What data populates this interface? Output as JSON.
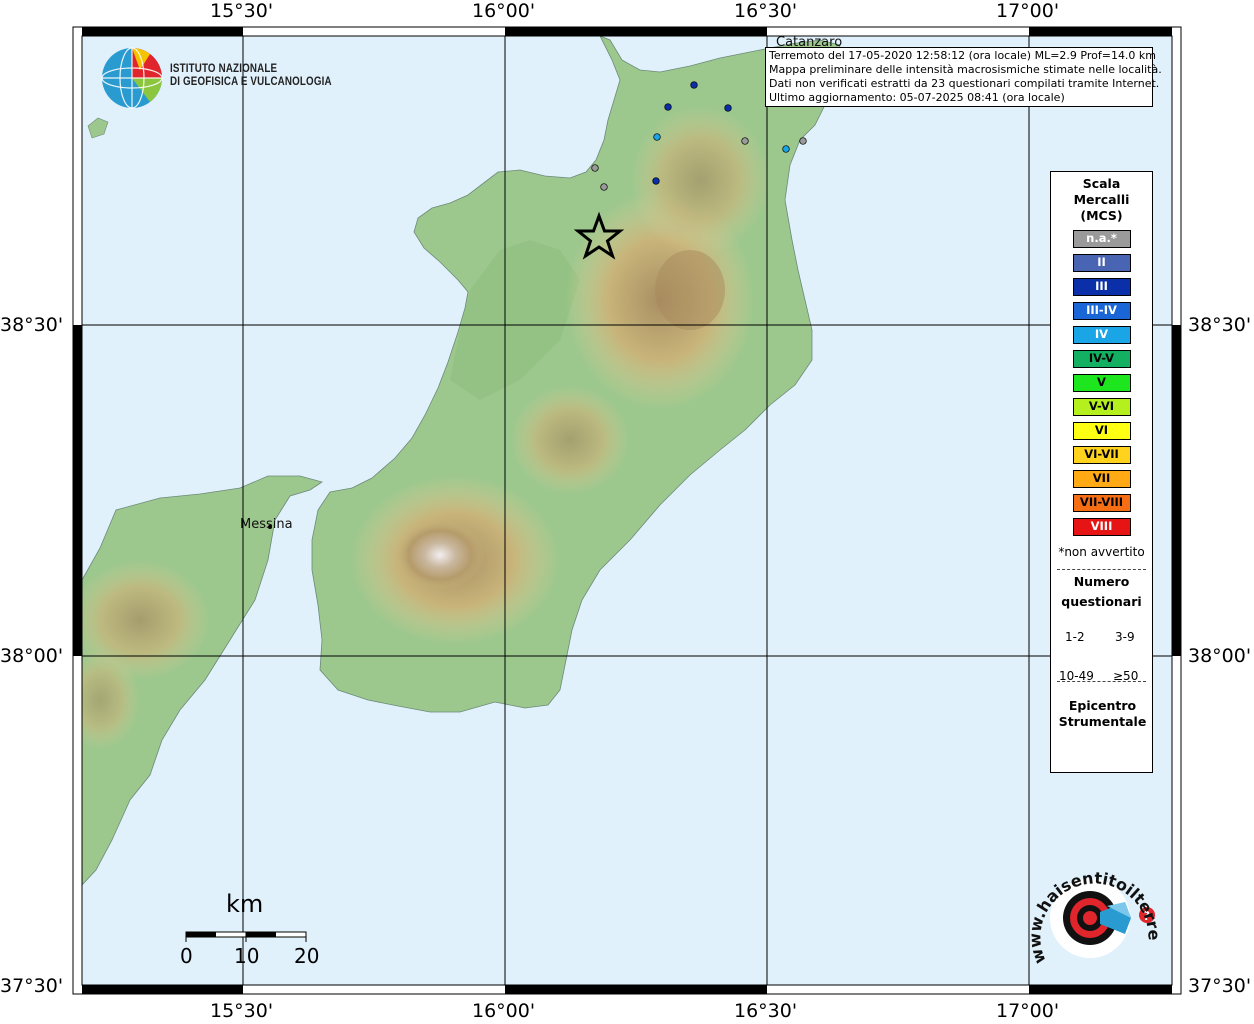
{
  "header": {
    "institute_line1": "ISTITUTO NAZIONALE",
    "institute_line2": "DI GEOFISICA E VULCANOLOGIA"
  },
  "info": {
    "line1": "Terremoto del 17-05-2020 12:58:12 (ora locale) ML=2.9 Prof=14.0 km",
    "line2": "Mappa preliminare delle intensità macrosismiche stimate nelle località.",
    "line3": "Dati non verificati estratti da 23 questionari compilati tramite Internet.",
    "line4": "Ultimo aggiornamento: 05-07-2025 08:41 (ora locale)"
  },
  "cities": {
    "catanzaro": "Catanzaro",
    "messina": "Messina"
  },
  "axes": {
    "lon_labels": [
      "15°30'",
      "16°00'",
      "16°30'",
      "17°00'"
    ],
    "lat_labels": [
      "38°30'",
      "38°00'",
      "37°30'"
    ]
  },
  "legend": {
    "title1": "Scala",
    "title2": "Mercalli",
    "title3": "(MCS)",
    "classes": [
      {
        "label": "n.a.*",
        "color": "#9a9a9a",
        "text": "#ffffff"
      },
      {
        "label": "II",
        "color": "#4a64b4",
        "text": "#ffffff"
      },
      {
        "label": "III",
        "color": "#0a2fa8",
        "text": "#ffffff"
      },
      {
        "label": "III-IV",
        "color": "#1a66d6",
        "text": "#ffffff"
      },
      {
        "label": "IV",
        "color": "#1aa6e6",
        "text": "#ffffff"
      },
      {
        "label": "IV-V",
        "color": "#12b060",
        "text": "#000000"
      },
      {
        "label": "V",
        "color": "#1ee61e",
        "text": "#000000"
      },
      {
        "label": "V-VI",
        "color": "#b4f01e",
        "text": "#000000"
      },
      {
        "label": "VI",
        "color": "#ffff14",
        "text": "#000000"
      },
      {
        "label": "VI-VII",
        "color": "#ffd21e",
        "text": "#000000"
      },
      {
        "label": "VII",
        "color": "#ffaa14",
        "text": "#000000"
      },
      {
        "label": "VII-VIII",
        "color": "#f56e14",
        "text": "#000000"
      },
      {
        "label": "VIII",
        "color": "#e61414",
        "text": "#ffffff"
      }
    ],
    "not_felt_note": "*non avvertito",
    "questionnaires_title1": "Numero",
    "questionnaires_title2": "questionari",
    "sizes": [
      "1-2",
      "3-9",
      "10-49",
      "≥50"
    ],
    "epicenter_title1": "Epicentro",
    "epicenter_title2": "Strumentale"
  },
  "scale_bar": {
    "unit": "km",
    "labels": [
      "0",
      "10",
      "20"
    ]
  },
  "observations": [
    {
      "intensity": "III",
      "color": "#0a2fa8"
    },
    {
      "intensity": "III",
      "color": "#0a2fa8"
    },
    {
      "intensity": "III",
      "color": "#0a2fa8"
    },
    {
      "intensity": "III",
      "color": "#0a2fa8"
    },
    {
      "intensity": "IV",
      "color": "#1aa6e6"
    },
    {
      "intensity": "IV",
      "color": "#1aa6e6"
    },
    {
      "intensity": "n.a.*",
      "color": "#9a9a9a"
    },
    {
      "intensity": "n.a.*",
      "color": "#9a9a9a"
    },
    {
      "intensity": "n.a.*",
      "color": "#9a9a9a"
    },
    {
      "intensity": "n.a.*",
      "color": "#9a9a9a"
    }
  ],
  "logo2": {
    "text": "www.haisentitoilterremoto.it"
  }
}
